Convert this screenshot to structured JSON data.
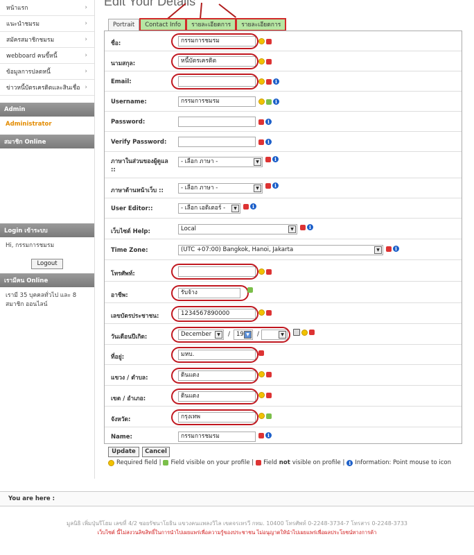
{
  "sidebar": {
    "items": [
      {
        "label": "หน้าแรก"
      },
      {
        "label": "แนะนำชมรม"
      },
      {
        "label": "สมัครสมาชิกชมรม"
      },
      {
        "label": "webboard คนขี้หนี้"
      },
      {
        "label": "ข้อมูลการปลดหนี้"
      },
      {
        "label": "ข่าวหนี้บัตรเครดิตและสินเชื่อ"
      }
    ],
    "admin_header": "Admin",
    "admin_link": "Administrator",
    "members_online_header": "สมาชิก Online",
    "login_header": "Login เข้าระบบ",
    "greeting": "Hi, กรรมการชมรม",
    "logout_label": "Logout",
    "who_online_header": "เรามีคน Online",
    "who_online_text": "เรามี 35 บุคคลทั่วไป และ 8 สมาชิก ออนไลน์"
  },
  "page_title": "Edit Your Details",
  "tabs": [
    {
      "label": "Portrait"
    },
    {
      "label": "Contact Info"
    },
    {
      "label": "รายละเอียดการ"
    },
    {
      "label": "รายละเอียดการ"
    }
  ],
  "form": {
    "name_label": "ชื่อ:",
    "name_value": "กรรมการชมรม",
    "lastname_label": "นามสกุล:",
    "lastname_value": "หนี้บัตรเครดิต",
    "email_label": "Email:",
    "email_value": "",
    "username_label": "Username:",
    "username_value": "กรรมการชมรม",
    "password_label": "Password:",
    "verify_label": "Verify Password:",
    "backend_lang_label": "ภาษาในส่วนของผู้ดูแล ::",
    "backend_lang_value": "- เลือก ภาษา -",
    "frontend_lang_label": "ภาษาด้านหน้าเว็บ ::",
    "frontend_lang_value": "- เลือก ภาษา -",
    "editor_label": "User Editor::",
    "editor_value": "- เลือก เอดิเตอร์ -",
    "help_label": "เว็บไซต์ Help:",
    "help_value": "Local",
    "timezone_label": "Time Zone:",
    "timezone_value": "(UTC +07:00) Bangkok, Hanoi, Jakarta",
    "phone_label": "โทรศัพท์:",
    "phone_value": "",
    "career_label": "อาชีพ:",
    "career_value": "รับจ้าง",
    "idcard_label": "เลขบัตรประชาชน:",
    "idcard_value": "1234567890000",
    "birthday_label": "วันเดือนปีเกิด:",
    "birth_month": "December",
    "birth_day": "19",
    "birth_year": "",
    "sep": "/",
    "address_label": "ที่อยู่:",
    "address_value": "มหบ.",
    "subdistrict_label": "แขวง / ตำบล:",
    "subdistrict_value": "ดินแดง",
    "district_label": "เขต / อำเภอ:",
    "district_value": "ดินแดง",
    "province_label": "จังหวัด:",
    "province_value": "กรุงเทพ",
    "displayname_label": "Name:",
    "displayname_value": "กรรมการชมรม"
  },
  "buttons": {
    "update": "Update",
    "cancel": "Cancel"
  },
  "legend": {
    "required": "Required field |",
    "visible": "Field visible on your profile |",
    "not_visible_a": "Field",
    "not_visible_b": "not",
    "not_visible_c": "visible on profile |",
    "information": "Information: Point mouse to icon"
  },
  "footer": {
    "you_are_here": "You are here :",
    "address": "มูลนิธิ เพิ่มปุ่นรีโฮม เลขที่ 4/2 ซอยรัชนาโยธิน แขวงคนแพลงวิไล เขตจรเหรวี กทม. 10400 โทรศัพท์ 0-2248-3734-7 โทรสาร 0-2248-3733",
    "notice": "เว็บไซต์ นี้ไม่สงวนลิขสิทธิ์ในการนำไปเผยแพร่เพื่อความรู้ของประชาชน ไม่อนุญาตให้นำไปเผยแพร่เพื่อผลประโยชน์ทางการค้า"
  },
  "colors": {
    "accent": "#e38b00",
    "tab_active": "#b6e6a2",
    "highlight": "#c0171f"
  }
}
